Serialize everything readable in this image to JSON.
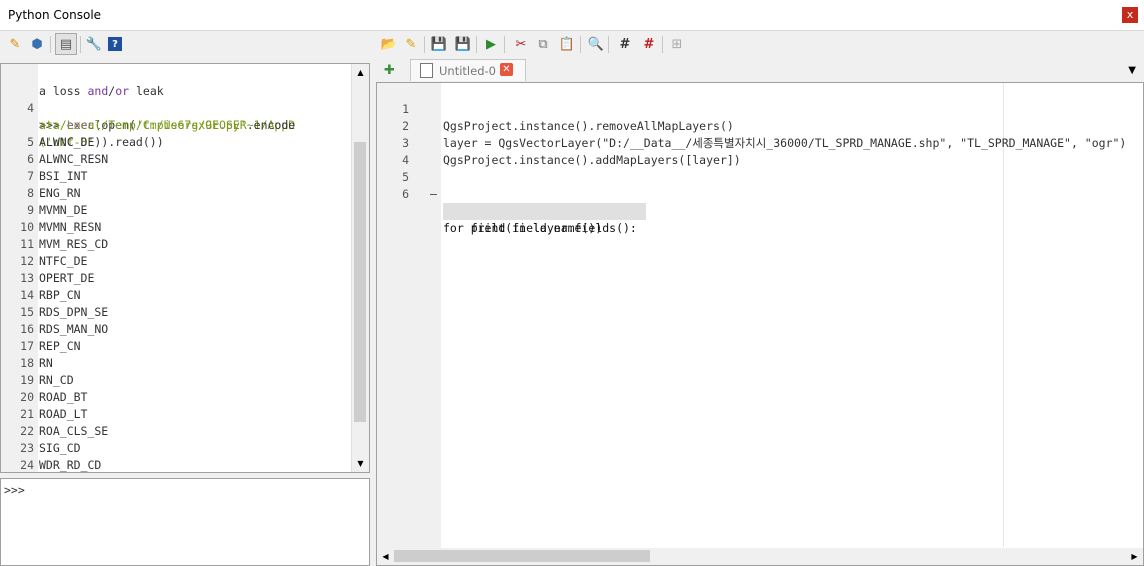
{
  "window": {
    "title": "Python Console",
    "close_glyph": "x"
  },
  "toolbar_left": [
    {
      "name": "clear-console-icon",
      "glyph": "✎",
      "color": "#d98b00"
    },
    {
      "name": "import-class-icon",
      "glyph": "⬢",
      "color": "#3a70b0"
    },
    {
      "name": "show-editor-icon",
      "glyph": "▤",
      "color": "#555",
      "active": true
    },
    {
      "name": "options-icon",
      "glyph": "🔧",
      "color": "#666"
    },
    {
      "name": "help-icon",
      "glyph": "?",
      "color": "#1f4f9f"
    }
  ],
  "toolbar_right": [
    {
      "name": "open-script-icon",
      "glyph": "📂",
      "color": "#d9a000"
    },
    {
      "name": "open-external-editor-icon",
      "glyph": "✎",
      "color": "#d9a000"
    },
    {
      "name": "save-icon",
      "glyph": "💾",
      "color": "#37607f"
    },
    {
      "name": "save-as-icon",
      "glyph": "💾",
      "color": "#37607f"
    },
    {
      "name": "run-script-icon",
      "glyph": "▶",
      "color": "#2d8a2d"
    },
    {
      "name": "cut-icon",
      "glyph": "✂",
      "color": "#b02020"
    },
    {
      "name": "copy-icon",
      "glyph": "⧉",
      "color": "#777"
    },
    {
      "name": "paste-icon",
      "glyph": "📋",
      "color": "#a07020"
    },
    {
      "name": "find-icon",
      "glyph": "🔍",
      "color": "#555"
    },
    {
      "name": "comment-icon",
      "glyph": "#",
      "color": "#333"
    },
    {
      "name": "uncomment-icon",
      "glyph": "#",
      "color": "#c02020"
    },
    {
      "name": "object-inspector-icon",
      "glyph": "⊞",
      "color": "#aaa"
    }
  ],
  "output": {
    "first_line": "a loss and/or leak",
    "exec_line4_num": "4",
    "exec_prompt": ">>> ",
    "exec_kw": "exec",
    "exec_part1": "(open(",
    "exec_str1": "'C:/Users/GEOSER~1/AppD",
    "exec_str2": "ata/Local/Temp/tmpie67gx9r.py'",
    "exec_part2": ".encode",
    "exec_str3": "('utf-8'",
    "exec_part3": ")).read())",
    "fields": [
      {
        "num": "5",
        "name": "ALWNC_DE"
      },
      {
        "num": "6",
        "name": "ALWNC_RESN"
      },
      {
        "num": "7",
        "name": "BSI_INT"
      },
      {
        "num": "8",
        "name": "ENG_RN"
      },
      {
        "num": "9",
        "name": "MVMN_DE"
      },
      {
        "num": "10",
        "name": "MVMN_RESN"
      },
      {
        "num": "11",
        "name": "MVM_RES_CD"
      },
      {
        "num": "12",
        "name": "NTFC_DE"
      },
      {
        "num": "13",
        "name": "OPERT_DE"
      },
      {
        "num": "14",
        "name": "RBP_CN"
      },
      {
        "num": "15",
        "name": "RDS_DPN_SE"
      },
      {
        "num": "16",
        "name": "RDS_MAN_NO"
      },
      {
        "num": "17",
        "name": "REP_CN"
      },
      {
        "num": "18",
        "name": "RN"
      },
      {
        "num": "19",
        "name": "RN_CD"
      },
      {
        "num": "20",
        "name": "ROAD_BT"
      },
      {
        "num": "21",
        "name": "ROAD_LT"
      },
      {
        "num": "22",
        "name": "ROA_CLS_SE"
      },
      {
        "num": "23",
        "name": "SIG_CD"
      },
      {
        "num": "24",
        "name": "WDR_RD_CD"
      }
    ],
    "first_a": "a loss ",
    "first_and": "and",
    "first_slash": "/",
    "first_or": "or",
    "first_rest": " leak"
  },
  "input": {
    "prompt": ">>>"
  },
  "editor": {
    "tab_label": "Untitled-0",
    "lines": [
      {
        "num": "1",
        "code": "QgsProject.instance().removeAllMapLayers()"
      },
      {
        "num": "2",
        "code": "layer = QgsVectorLayer(\"D:/__Data__/세종특별자치시_36000/TL_SPRD_MANAGE.shp\", \"TL_SPRD_MANAGE\", \"ogr\")"
      },
      {
        "num": "3",
        "code": "QgsProject.instance().addMapLayers([layer])"
      },
      {
        "num": "4",
        "code": ""
      },
      {
        "num": "5",
        "code": "for field in layer.fields():"
      },
      {
        "num": "6",
        "code": "    print(field.name())"
      }
    ]
  },
  "colors": {
    "keyword": "#7a38a5",
    "string": "#7a9a1a",
    "close": "#c42b1c"
  }
}
